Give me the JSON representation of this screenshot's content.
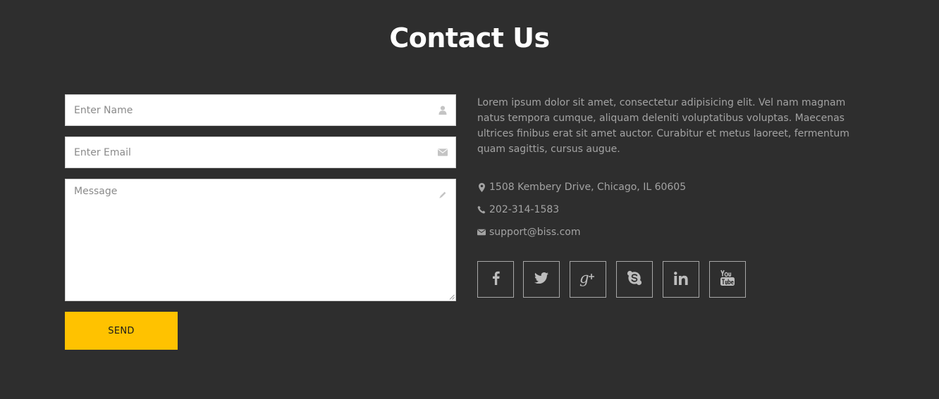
{
  "heading": "Contact Us",
  "form": {
    "name_placeholder": "Enter Name",
    "email_placeholder": "Enter Email",
    "message_placeholder": "Message",
    "name_icon": "user-icon",
    "email_icon": "envelope-icon",
    "message_icon": "pencil-icon",
    "send_label": "SEND"
  },
  "about_text": "Lorem ipsum dolor sit amet, consectetur adipisicing elit. Vel nam magnam natus tempora cumque, aliquam deleniti voluptatibus voluptas. Maecenas ultrices finibus erat sit amet auctor. Curabitur et metus laoreet, fermentum quam sagittis, cursus augue.",
  "contact": {
    "address": "1508 Kembery Drive, Chicago, IL 60605",
    "phone": "202-314-1583",
    "email": "support@biss.com"
  },
  "social": [
    {
      "icon": "facebook-icon"
    },
    {
      "icon": "twitter-icon"
    },
    {
      "icon": "google-plus-icon"
    },
    {
      "icon": "skype-icon"
    },
    {
      "icon": "linkedin-icon"
    },
    {
      "icon": "youtube-icon"
    }
  ],
  "colors": {
    "background": "#2e2e2e",
    "accent": "#ffc200",
    "text_muted": "#a3a3a3"
  }
}
